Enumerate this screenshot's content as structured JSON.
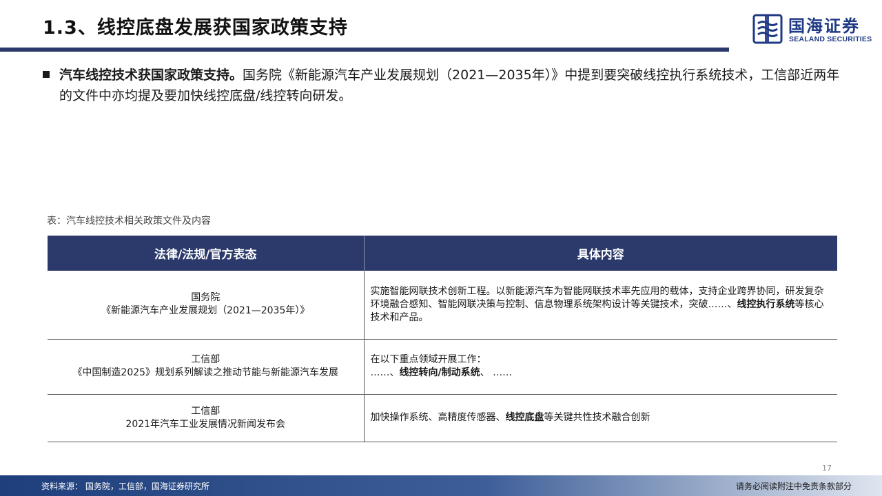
{
  "header": {
    "title": "1.3、线控底盘发展获国家政策支持",
    "logo_cn": "国海证券",
    "logo_en": "SEALAND SECURITIES"
  },
  "intro": {
    "bold": "汽车线控技术获国家政策支持。",
    "text": "国务院《新能源汽车产业发展规划（2021—2035年）》中提到要突破线控执行系统技术，工信部近两年的文件中亦均提及要加快线控底盘/线控转向研发。"
  },
  "table": {
    "caption": "表：汽车线控技术相关政策文件及内容",
    "headers": [
      "法律/法规/官方表态",
      "具体内容"
    ],
    "rows": [
      {
        "issuer": "国务院",
        "document": "《新能源汽车产业发展规划（2021—2035年）》",
        "content_pre": "实施智能网联技术创新工程。以新能源汽车为智能网联技术率先应用的载体，支持企业跨界协同，研发复杂环境融合感知、智能网联决策与控制、信息物理系统架构设计等关键技术，突破……、",
        "content_bold": "线控执行系统",
        "content_post": "等核心技术和产品。"
      },
      {
        "issuer": "工信部",
        "document": "《中国制造2025》规划系列解读之推动节能与新能源汽车发展",
        "content_line1": "在以下重点领域开展工作：",
        "content_pre": "……、",
        "content_bold": "线控转向/制动系统",
        "content_post": "、 ……"
      },
      {
        "issuer": "工信部",
        "document": "2021年汽车工业发展情况新闻发布会",
        "content_pre": "加快操作系统、高精度传感器、",
        "content_bold": "线控底盘",
        "content_post": "等关键共性技术融合创新"
      }
    ]
  },
  "page_number": "17",
  "footer": {
    "source": "资料来源：  国务院，工信部，国海证券研究所",
    "disclaimer": "请务必阅读附注中免责条款部分"
  },
  "colors": {
    "brand_navy": "#2b3a6b",
    "logo_blue": "#1f3a84"
  }
}
